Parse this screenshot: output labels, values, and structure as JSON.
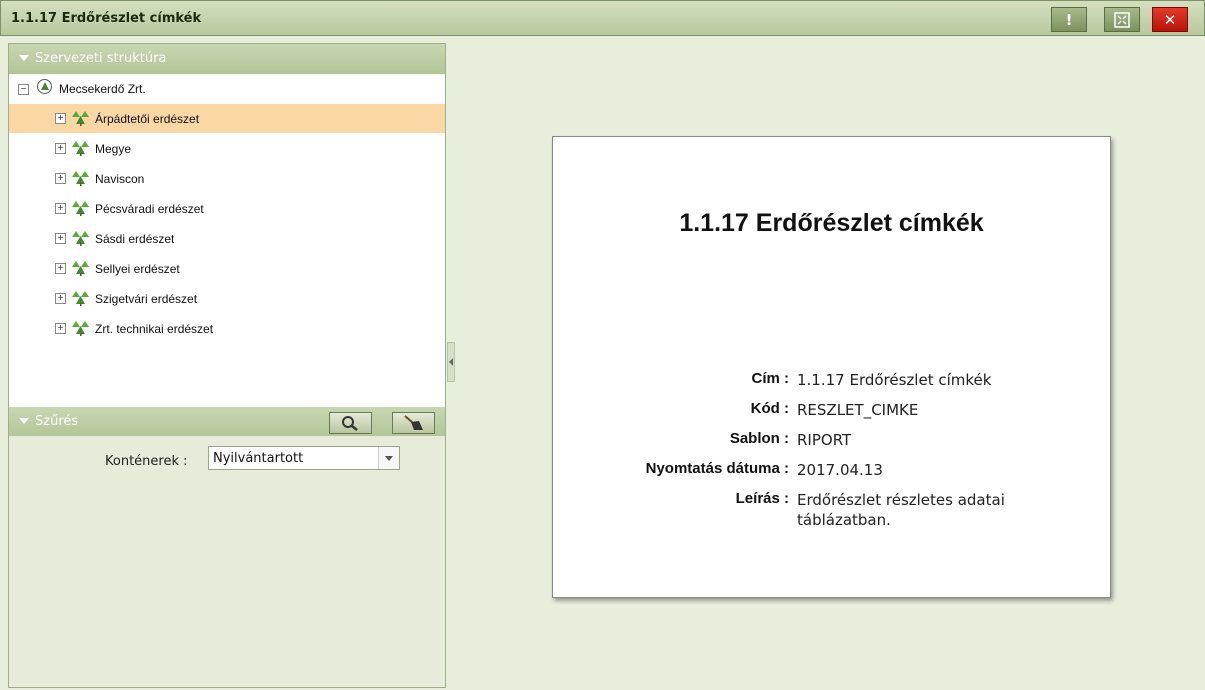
{
  "window": {
    "title": "1.1.17 Erdőrészlet címkék",
    "btn_info": "!",
    "btn_close": "✕"
  },
  "tree_section": {
    "title": "Szervezeti struktúra",
    "root": "Mecsekerdő Zrt.",
    "items": [
      {
        "label": "Árpádtetői erdészet"
      },
      {
        "label": "Megye"
      },
      {
        "label": "Naviscon"
      },
      {
        "label": "Pécsváradi erdészet"
      },
      {
        "label": "Sásdi erdészet"
      },
      {
        "label": "Sellyei erdészet"
      },
      {
        "label": "Szigetvári erdészet"
      },
      {
        "label": "Zrt. technikai erdészet"
      }
    ]
  },
  "filter_section": {
    "title": "Szűrés",
    "containers_label": "Konténerek :",
    "containers_value": "Nyilvántartott"
  },
  "report": {
    "title": "1.1.17 Erdőrészlet címkék",
    "fields": [
      {
        "key": "Cím :",
        "value": "1.1.17 Erdőrészlet címkék"
      },
      {
        "key": "Kód :",
        "value": "RESZLET_CIMKE"
      },
      {
        "key": "Sablon :",
        "value": "RIPORT"
      },
      {
        "key": "Nyomtatás dátuma :",
        "value": "2017.04.13"
      },
      {
        "key": "Leírás :",
        "value": "Erdőrészlet részletes adatai táblázatban."
      }
    ]
  },
  "colors": {
    "selected_row": "#fbd7a6",
    "header_green": "#b4c597",
    "close_red": "#d02517"
  }
}
